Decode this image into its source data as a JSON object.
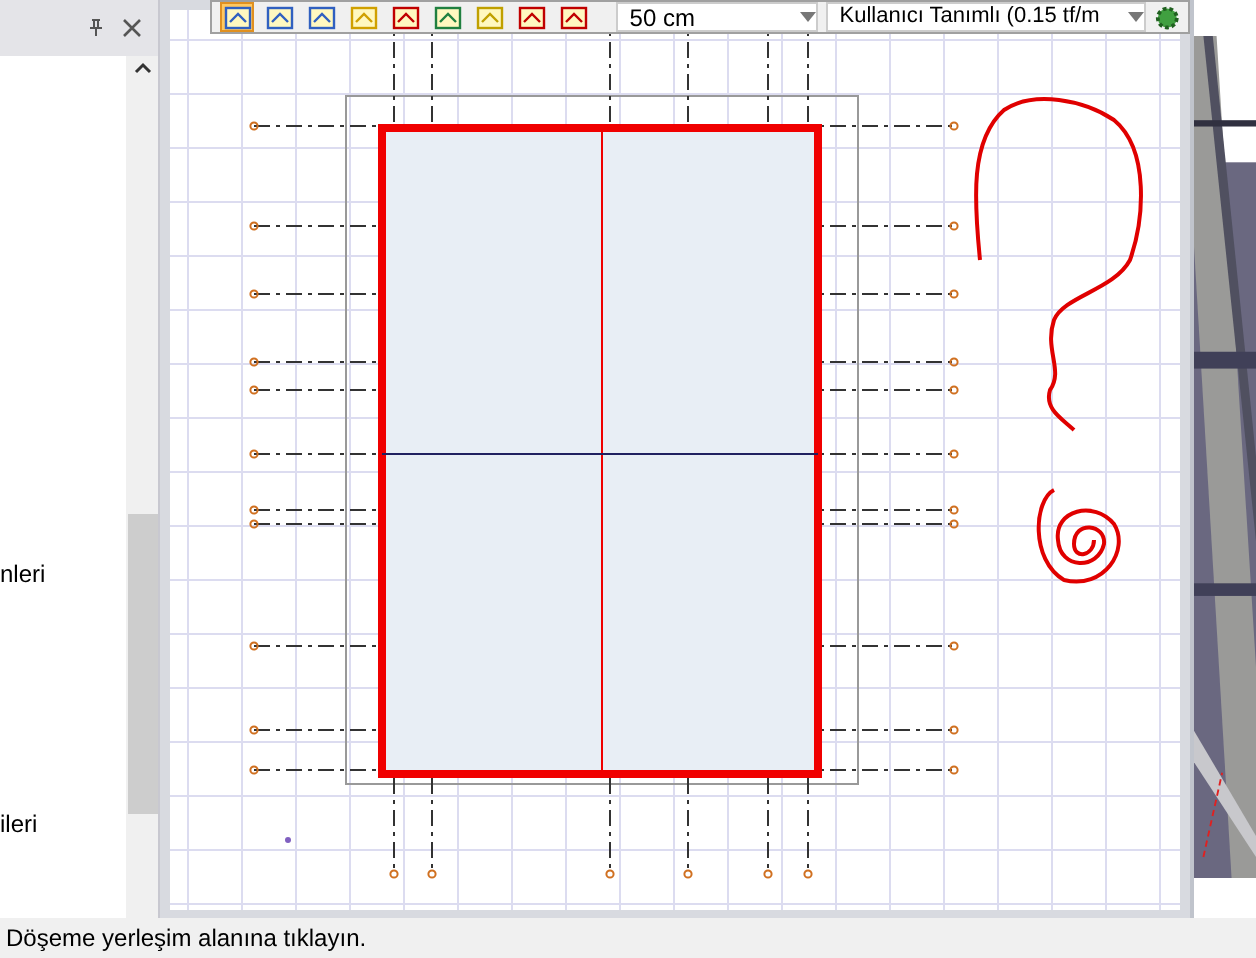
{
  "left_panel": {
    "items": [
      {
        "label": "nleri"
      },
      {
        "label": "ileri"
      }
    ]
  },
  "toolbar": {
    "tools": [
      {
        "selected": true
      },
      {
        "selected": false
      },
      {
        "selected": false
      },
      {
        "selected": false
      },
      {
        "selected": false
      },
      {
        "selected": false
      },
      {
        "selected": false
      },
      {
        "selected": false
      },
      {
        "selected": false
      }
    ],
    "thickness": "50 cm",
    "load": "Kullanıcı Tanımlı (0.15 tf/m"
  },
  "status_bar": "Döşeme yerleşim alanına tıklayın."
}
